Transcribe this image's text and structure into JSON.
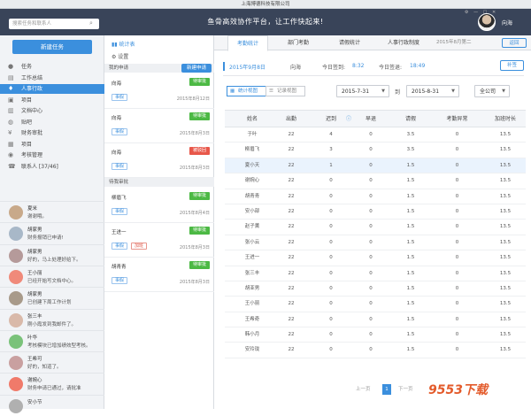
{
  "window": {
    "title": "上海博德科技有限公司"
  },
  "header": {
    "search_placeholder": "搜索任务和联系人",
    "slogan": "鱼骨高效协作平台，让工作快起来!",
    "user": "向海"
  },
  "sidebar": {
    "new_task": "新建任务",
    "items": [
      {
        "icon": "task-icon",
        "glyph": "●",
        "label": "任务"
      },
      {
        "icon": "summary-icon",
        "glyph": "▤",
        "label": "工作总结"
      },
      {
        "icon": "hr-icon",
        "glyph": "♦",
        "label": "人事行政",
        "active": true
      },
      {
        "icon": "folder-icon",
        "glyph": "▣",
        "label": "项目"
      },
      {
        "icon": "doc-icon",
        "glyph": "▥",
        "label": "文档中心"
      },
      {
        "icon": "post-icon",
        "glyph": "◍",
        "label": "贴吧"
      },
      {
        "icon": "finance-icon",
        "glyph": "¥",
        "label": "财务审批"
      },
      {
        "icon": "project-icon",
        "glyph": "▦",
        "label": "项目"
      },
      {
        "icon": "exam-icon",
        "glyph": "◉",
        "label": "考核管理"
      },
      {
        "icon": "contacts-icon",
        "glyph": "☎",
        "label": "联系人 [37/46]"
      }
    ],
    "chats": [
      {
        "name": "夏米",
        "msg": "谢谢哦。",
        "color": "#c8a98a"
      },
      {
        "name": "胡家男",
        "msg": "财务报销已申请!",
        "color": "#a8b8c8"
      },
      {
        "name": "胡家男",
        "msg": "好的，马上处理好给下。",
        "color": "#b59a9a"
      },
      {
        "name": "王小丽",
        "msg": "已经开始写文档中心。",
        "color": "#f08a7a"
      },
      {
        "name": "胡家男",
        "msg": "已创建下周工作计划",
        "color": "#a89a8a"
      },
      {
        "name": "张三丰",
        "msg": "刚小霞发到我邮件了。",
        "color": "#d9b9a9"
      },
      {
        "name": "叶华",
        "msg": "考核模块已增加绩效型考核。",
        "color": "#7ac27a"
      },
      {
        "name": "王希可",
        "msg": "好的，知道了。",
        "color": "#c9a0a0"
      },
      {
        "name": "谢婉心",
        "msg": "财务申请已通过，请批准",
        "color": "#f07a6a"
      },
      {
        "name": "安小节",
        "msg": "",
        "color": "#b0b0b0"
      }
    ]
  },
  "middle": {
    "tabs": [
      "统计表",
      "设置"
    ],
    "section1": "我的申请",
    "new_apply": "新建申请",
    "section2": "待我审批",
    "requests": [
      {
        "name": "向海",
        "tags": [
          "事假"
        ],
        "status": "待审批",
        "date": "2015年8月12日",
        "status_color": "green"
      },
      {
        "name": "向海",
        "tags": [
          "事假"
        ],
        "status": "待审批",
        "date": "2015年8月3日",
        "status_color": "green"
      },
      {
        "name": "向海",
        "tags": [
          "事假"
        ],
        "status": "被驳回",
        "date": "2015年8月3日",
        "status_color": "red"
      }
    ],
    "approvals": [
      {
        "name": "柳眉飞",
        "tags": [
          "事假"
        ],
        "status": "待审批",
        "date": "2015年8月4日",
        "status_color": "green"
      },
      {
        "name": "王进一",
        "tags": [
          "事假",
          "加班"
        ],
        "status": "待审批",
        "date": "2015年8月3日",
        "status_color": "green"
      },
      {
        "name": "胡青青",
        "tags": [
          "事假"
        ],
        "status": "待审批",
        "date": "2015年8月3日",
        "status_color": "green"
      }
    ]
  },
  "main": {
    "tabs": [
      "考勤统计",
      "部门考勤",
      "请假统计",
      "人事行政制度"
    ],
    "tab_date": "2015年8月第二",
    "back": "返回",
    "info": {
      "date": "2015年9月8日",
      "user": "向海",
      "checkin_label": "今日签到:",
      "checkin": "8:32",
      "checkout_label": "今日签退:",
      "checkout": "18:49"
    },
    "supplement": "补签",
    "view_stats": "统计视图",
    "view_records": "记录视图",
    "date_from": "2015-7-31",
    "date_to_label": "到",
    "date_to": "2015-8-31",
    "company": "全公司",
    "columns": [
      "姓名",
      "出勤",
      "迟到",
      "早退",
      "请假",
      "考勤异常",
      "加班时长"
    ],
    "rows": [
      [
        "于叶",
        "22",
        "4",
        "0",
        "3.5",
        "0",
        "13.5"
      ],
      [
        "柳眉飞",
        "22",
        "3",
        "0",
        "3.5",
        "0",
        "13.5"
      ],
      [
        "夏小天",
        "22",
        "1",
        "0",
        "1.5",
        "0",
        "13.5"
      ],
      [
        "谢婉心",
        "22",
        "0",
        "0",
        "1.5",
        "0",
        "13.5"
      ],
      [
        "胡青青",
        "22",
        "0",
        "0",
        "1.5",
        "0",
        "13.5"
      ],
      [
        "安小部",
        "22",
        "0",
        "0",
        "1.5",
        "0",
        "13.5"
      ],
      [
        "赵子薰",
        "22",
        "0",
        "0",
        "1.5",
        "0",
        "13.5"
      ],
      [
        "张小云",
        "22",
        "0",
        "0",
        "1.5",
        "0",
        "13.5"
      ],
      [
        "王进一",
        "22",
        "0",
        "0",
        "1.5",
        "0",
        "13.5"
      ],
      [
        "张三丰",
        "22",
        "0",
        "0",
        "1.5",
        "0",
        "13.5"
      ],
      [
        "胡亚男",
        "22",
        "0",
        "0",
        "1.5",
        "0",
        "13.5"
      ],
      [
        "王小丽",
        "22",
        "0",
        "0",
        "1.5",
        "0",
        "13.5"
      ],
      [
        "王希奇",
        "22",
        "0",
        "0",
        "1.5",
        "0",
        "13.5"
      ],
      [
        "韩小月",
        "22",
        "0",
        "0",
        "1.5",
        "0",
        "13.5"
      ],
      [
        "安玲珑",
        "22",
        "0",
        "0",
        "1.5",
        "0",
        "13.5"
      ]
    ],
    "pager": {
      "prev": "上一页",
      "current": "1",
      "next": "下一页"
    }
  },
  "watermark": "9553下载"
}
